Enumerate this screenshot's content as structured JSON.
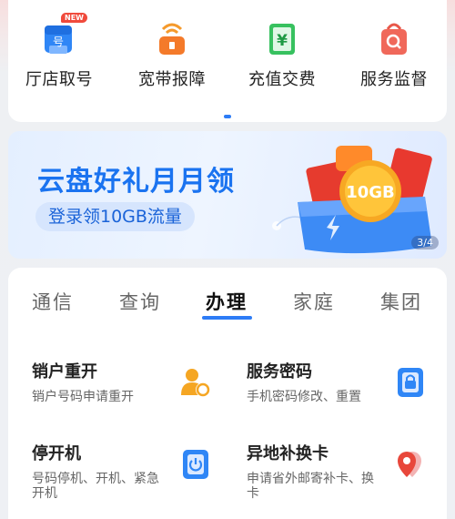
{
  "quick_services": [
    {
      "label": "厅店取号",
      "icon": "ticket-icon",
      "badge": "NEW"
    },
    {
      "label": "宽带报障",
      "icon": "router-icon"
    },
    {
      "label": "充值交费",
      "icon": "yuan-icon"
    },
    {
      "label": "服务监督",
      "icon": "magnifier-bag-icon"
    }
  ],
  "carousel": {
    "page_indicator": "3/4"
  },
  "banner": {
    "title": "云盘好礼月月领",
    "subtitle": "登录领10GB流量",
    "coin_text": "10GB"
  },
  "tabs": [
    {
      "label": "通信",
      "active": false
    },
    {
      "label": "查询",
      "active": false
    },
    {
      "label": "办理",
      "active": true
    },
    {
      "label": "家庭",
      "active": false
    },
    {
      "label": "集团",
      "active": false
    }
  ],
  "services": [
    {
      "title": "销户重开",
      "desc": "销户号码申请重开",
      "icon": "user-refresh-icon"
    },
    {
      "title": "服务密码",
      "desc": "手机密码修改、重置",
      "icon": "lock-icon"
    },
    {
      "title": "停开机",
      "desc": "号码停机、开机、紧急开机",
      "icon": "power-icon"
    },
    {
      "title": "异地补换卡",
      "desc": "申请省外邮寄补卡、换卡",
      "icon": "location-pin-icon"
    }
  ],
  "colors": {
    "accent": "#2d7cf6",
    "banner_title": "#1a73f0"
  }
}
